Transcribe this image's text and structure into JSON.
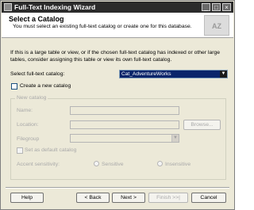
{
  "window": {
    "title": "Full-Text Indexing Wizard",
    "minimize_icon": "_",
    "maximize_icon": "□",
    "close_icon": "×"
  },
  "header": {
    "title": "Select a Catalog",
    "subtitle": "You must select an existing full-text catalog or create one for this database.",
    "logo_text": "AZ"
  },
  "intro_text_line1": "If this is a large table or view, or if the chosen full-text catalog has indexed or other large",
  "intro_text_line2": "tables, consider assigning this table or view its own full-text catalog.",
  "catalog_select": {
    "label": "Select full-text catalog:",
    "value": "Cat_AdventureWorks"
  },
  "create_new_catalog": {
    "label": "Create a new catalog",
    "checked": false
  },
  "new_catalog_group": {
    "legend": "New catalog",
    "name_label": "Name:",
    "location_label": "Location:",
    "browse_button": "Browse...",
    "filegroup_label": "Filegroup",
    "set_default_label": "Set as default catalog",
    "accent_label": "Accent sensitivity:",
    "sensitive_label": "Sensitive",
    "insensitive_label": "Insensitive"
  },
  "buttons": {
    "help": "Help",
    "back": "< Back",
    "next": "Next >",
    "finish": "Finish >>|",
    "cancel": "Cancel"
  }
}
